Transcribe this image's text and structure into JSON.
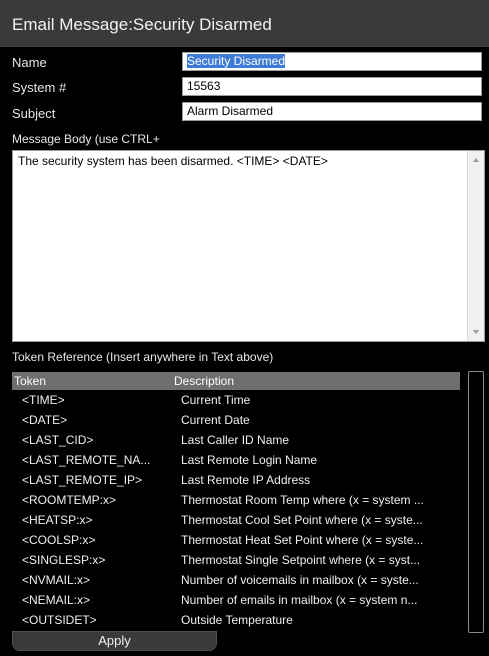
{
  "window": {
    "title": "Email Message:Security Disarmed"
  },
  "form": {
    "name_label": "Name",
    "name_value": "Security Disarmed",
    "system_label": "System #",
    "system_value": "15563",
    "subject_label": "Subject",
    "subject_value": "Alarm Disarmed"
  },
  "message": {
    "label": "Message Body (use CTRL+",
    "body": "The security system has been disarmed. <TIME> <DATE>"
  },
  "tokens": {
    "label": "Token Reference (Insert anywhere in Text above)",
    "columns": {
      "token": "Token",
      "description": "Description"
    },
    "rows": [
      {
        "token": "<TIME>",
        "description": "Current Time"
      },
      {
        "token": "<DATE>",
        "description": "Current Date"
      },
      {
        "token": "<LAST_CID>",
        "description": "Last Caller ID Name"
      },
      {
        "token": "<LAST_REMOTE_NA...",
        "description": "Last Remote Login Name"
      },
      {
        "token": "<LAST_REMOTE_IP>",
        "description": "Last Remote IP Address"
      },
      {
        "token": "<ROOMTEMP:x>",
        "description": "Thermostat Room Temp where (x = system ..."
      },
      {
        "token": "<HEATSP:x>",
        "description": "Thermostat Cool Set Point where (x = syste..."
      },
      {
        "token": "<COOLSP:x>",
        "description": "Thermostat Heat Set Point where (x = syste..."
      },
      {
        "token": "<SINGLESP:x>",
        "description": "Thermostat Single Setpoint where (x = syst..."
      },
      {
        "token": "<NVMAIL:x>",
        "description": "Number of voicemails in mailbox (x = syste..."
      },
      {
        "token": "<NEMAIL:x>",
        "description": "Number of emails in mailbox (x = system n..."
      },
      {
        "token": "<OUTSIDET>",
        "description": "Outside Temperature"
      }
    ]
  },
  "actions": {
    "apply_label": "Apply"
  },
  "colors": {
    "background": "#000000",
    "title_bar": "#3a3a3a",
    "table_header": "#6e6e6e",
    "selection": "#3d7bd6"
  }
}
